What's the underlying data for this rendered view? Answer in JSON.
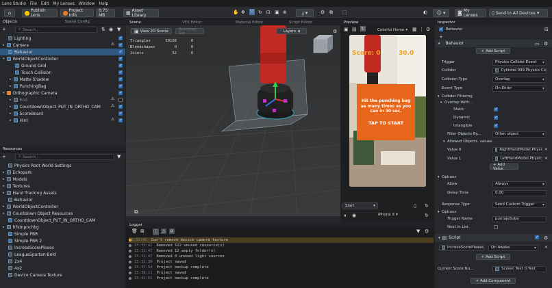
{
  "menu": {
    "items": [
      "Lens Studio",
      "File",
      "Edit",
      "My Lenses",
      "Window",
      "Help"
    ]
  },
  "toolbar": {
    "publish_label": "Publish Lens",
    "project_info_label": "Project Info",
    "size_label": "0.75 MB",
    "asset_library_label": "Asset Library",
    "my_lenses_label": "My Lenses",
    "send_label": "Send to All Devices"
  },
  "objects": {
    "tabs": [
      "Objects",
      "Scene Config"
    ],
    "search_placeholder": "Search...",
    "items": [
      {
        "label": "Lighting",
        "indent": 1
      },
      {
        "label": "Camera",
        "indent": 1
      },
      {
        "label": "Behavior",
        "indent": 1
      },
      {
        "label": "WorldObjectController",
        "indent": 1
      },
      {
        "label": "Ground Grid",
        "indent": 2
      },
      {
        "label": "Touch Collision",
        "indent": 2
      },
      {
        "label": "Matte Shadow",
        "indent": 2
      },
      {
        "label": "PunchingBag",
        "indent": 2
      },
      {
        "label": "Orthographic Camera",
        "indent": 1
      },
      {
        "label": "End",
        "indent": 2
      },
      {
        "label": "CountdownObject_PUT_IN_ORTHO_CAM",
        "indent": 2
      },
      {
        "label": "ScoreBoard",
        "indent": 2
      },
      {
        "label": "Hint",
        "indent": 2
      }
    ]
  },
  "resources": {
    "title": "Resources",
    "search_placeholder": "Search...",
    "items": [
      "Physics Root World Settings",
      "Echopark",
      "Models",
      "Textures",
      "Hand Tracking Assets",
      "Behavior",
      "WorldObjectController",
      "Countdown Object Resources",
      "CountdownObject_PUT_IN_ORTHO_CAM",
      "frfstnpnchbg",
      "Simple PBR",
      "Simple PBR 2",
      "IncreseScorePlease",
      "LeagueSpartan-Bold",
      "2x4",
      "4x2",
      "Device Camera Texture"
    ]
  },
  "scene": {
    "tabs": [
      "Scene",
      "VFX Editor",
      "Material Editor",
      "Script Editor"
    ],
    "view2d_label": "View 2D Scene",
    "selection_set_label": "Selection Set",
    "layers_label": "Layers",
    "stats": [
      {
        "label": "Triangles",
        "value": "10108",
        "extra": "0"
      },
      {
        "label": "Blendshapes",
        "value": "0",
        "extra": "0"
      },
      {
        "label": "Joints",
        "value": "52",
        "extra": "0"
      }
    ]
  },
  "preview": {
    "title": "Preview",
    "home_label": "Colorful Home",
    "score_label": "Score:",
    "score_value": "0",
    "timer_value": "30.0",
    "hint_text": "Hit the punching bag as many times as you can in 30 sec.",
    "tap_text": "TAP TO START",
    "start_label": "Start",
    "device_label": "iPhone X"
  },
  "logger": {
    "title": "Logger",
    "rows": [
      {
        "time": "15:31:46",
        "msg": "Can't remove device camera texture",
        "warn": true
      },
      {
        "time": "15:31:47",
        "msg": "Removed 122 unused resource(s)",
        "warn": false
      },
      {
        "time": "15:31:47",
        "msg": "Removed 12 empty folder(s)",
        "warn": false
      },
      {
        "time": "15:31:47",
        "msg": "Removed 0 unused light sources",
        "warn": false
      },
      {
        "time": "15:32:30",
        "msg": "Project saved",
        "warn": false
      },
      {
        "time": "15:37:54",
        "msg": "Project backup complete",
        "warn": false
      },
      {
        "time": "15:38:11",
        "msg": "Project saved",
        "warn": false
      },
      {
        "time": "15:42:01",
        "msg": "Project backup complete",
        "warn": false
      }
    ]
  },
  "inspector": {
    "title": "Inspector",
    "object_name": "Behavior",
    "component_name": "Behavior",
    "add_script_label": "+ Add Script",
    "fields": {
      "trigger": {
        "label": "Trigger",
        "value": "Physics Collider Event"
      },
      "collider": {
        "label": "Collider",
        "value": "Cylinder.009.Physics Co"
      },
      "collision_type": {
        "label": "Collision Type",
        "value": "Overlap"
      },
      "event_type": {
        "label": "Event Type",
        "value": "On Enter"
      },
      "collider_filtering": {
        "label": "Collider Filtering"
      },
      "overlap_with": {
        "label": "Overlap With..."
      },
      "static": {
        "label": "Static"
      },
      "dynamic": {
        "label": "Dynamic"
      },
      "intangible": {
        "label": "Intangible"
      },
      "filter_objects": {
        "label": "Filter Objects By...",
        "value": "Other object"
      },
      "allowed_objects": {
        "label": "Allowed Objects, values"
      },
      "value0": {
        "label": "Value 0",
        "value": "RightHandModel.Physi"
      },
      "value1": {
        "label": "Value 1",
        "value": "LeftHandModel.Physic"
      },
      "add_value_label": "+ Add Value",
      "options_label": "Options",
      "allow": {
        "label": "Allow",
        "value": "Always"
      },
      "delay_time": {
        "label": "Delay Time",
        "value": "0.00"
      },
      "response_type": {
        "label": "Response Type",
        "value": "Send Custom Trigger"
      },
      "options2_label": "Options",
      "trigger_name": {
        "label": "Trigger Name",
        "value": "puntajeSube"
      },
      "next_in_list": {
        "label": "Next In List"
      }
    },
    "script": {
      "title": "Script",
      "name": "IncreseScorePlease",
      "event": "On Awake",
      "add_script_label": "+ Add Script",
      "current_score_label": "Current Score Nu...",
      "current_score_value": "Screen Text 0.Text"
    },
    "add_component_label": "+ Add Component"
  },
  "colors": {
    "accent": "#2f6fb0",
    "selection": "#31587f",
    "preview_orange": "#e8651c",
    "score_text": "#f0a020",
    "publish_yellow": "#f3c600",
    "project_info_orange": "#e87a2c"
  }
}
